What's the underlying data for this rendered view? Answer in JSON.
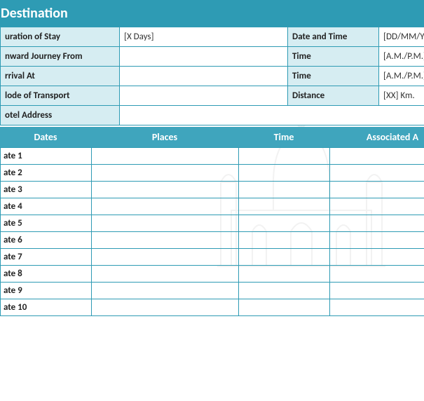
{
  "section": {
    "title": "Destination"
  },
  "info": {
    "rows": [
      {
        "label_a": "uration of Stay",
        "value_a": "[X Days]",
        "label_b": "Date and Time",
        "value_b": "[DD/MM/YYY"
      },
      {
        "label_a": "nward Journey From",
        "value_a": "",
        "label_b": "Time",
        "value_b": "[A.M./P.M.]"
      },
      {
        "label_a": "rrival At",
        "value_a": "",
        "label_b": "Time",
        "value_b": "[A.M./P.M.]"
      },
      {
        "label_a": "lode of Transport",
        "value_a": "",
        "label_b": "Distance",
        "value_b": "[XX] Km."
      }
    ],
    "hotel_label": "otel Address",
    "hotel_value": ""
  },
  "schedule": {
    "headers": {
      "dates": "Dates",
      "places": "Places",
      "time": "Time",
      "activities": "Associated A"
    },
    "rows": [
      {
        "date": "ate 1"
      },
      {
        "date": "ate 2"
      },
      {
        "date": "ate 3"
      },
      {
        "date": "ate 4"
      },
      {
        "date": "ate 5"
      },
      {
        "date": "ate 6"
      },
      {
        "date": "ate 7"
      },
      {
        "date": "ate 8"
      },
      {
        "date": "ate 9"
      },
      {
        "date": "ate 10"
      }
    ]
  }
}
